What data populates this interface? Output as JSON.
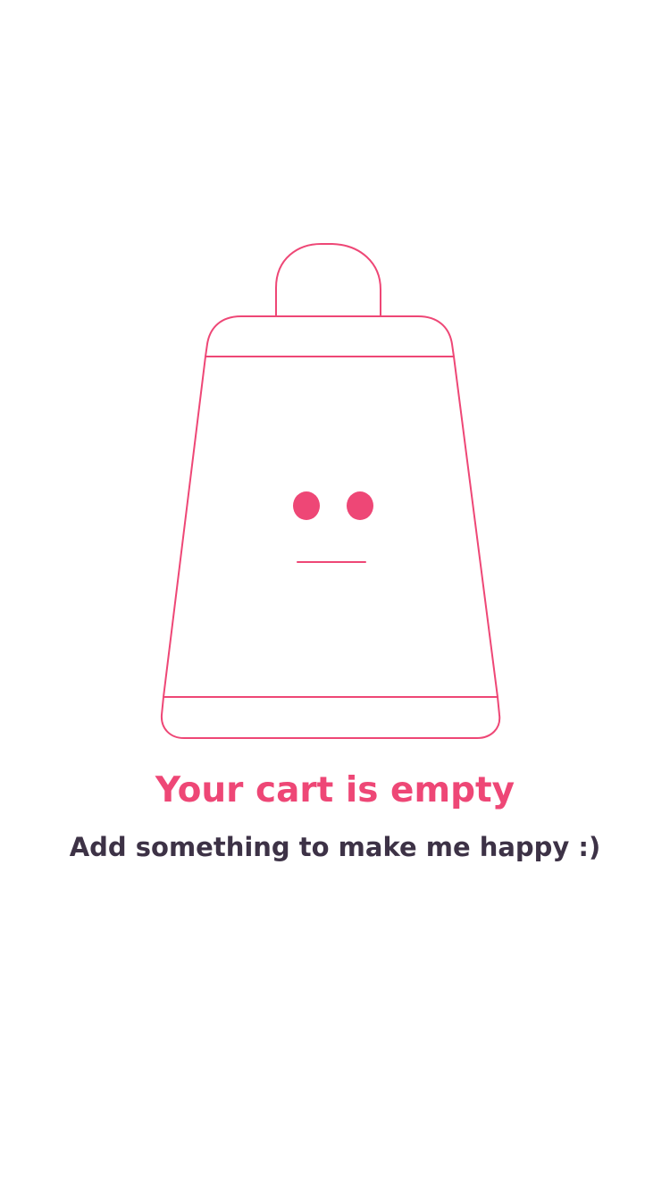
{
  "empty_state": {
    "title": "Your cart is empty",
    "subtitle": "Add something to make me happy :)",
    "illustration_icon": "empty-shopping-bag-icon"
  },
  "colors": {
    "accent": "#ee4776",
    "text_dark": "#3d3246",
    "background": "#ffffff"
  }
}
